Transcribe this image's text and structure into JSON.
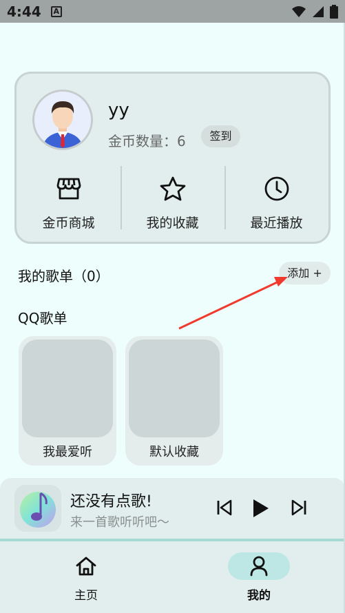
{
  "status_bar": {
    "time": "4:44",
    "notif_icon": "A"
  },
  "profile": {
    "username": "yy",
    "coin_label": "金币数量：6",
    "checkin_label": "签到"
  },
  "quick_actions": [
    {
      "icon": "store-icon",
      "label": "金币商城"
    },
    {
      "icon": "star-icon",
      "label": "我的收藏"
    },
    {
      "icon": "clock-icon",
      "label": "最近播放"
    }
  ],
  "my_playlists": {
    "title": "我的歌单（0）",
    "add_label": "添加 +"
  },
  "qq_playlists": {
    "title": "QQ歌单",
    "items": [
      {
        "name": "我最爱听"
      },
      {
        "name": "默认收藏"
      }
    ]
  },
  "player": {
    "title": "还没有点歌!",
    "subtitle": "来一首歌听听吧～"
  },
  "bottom_nav": [
    {
      "icon": "home-icon",
      "label": "主页",
      "active": false
    },
    {
      "icon": "person-icon",
      "label": "我的",
      "active": true
    }
  ],
  "colors": {
    "background": "#eefefc",
    "card": "#e2eeed",
    "nav_active": "#bce7e5",
    "annotation_arrow": "#f03a2e"
  }
}
